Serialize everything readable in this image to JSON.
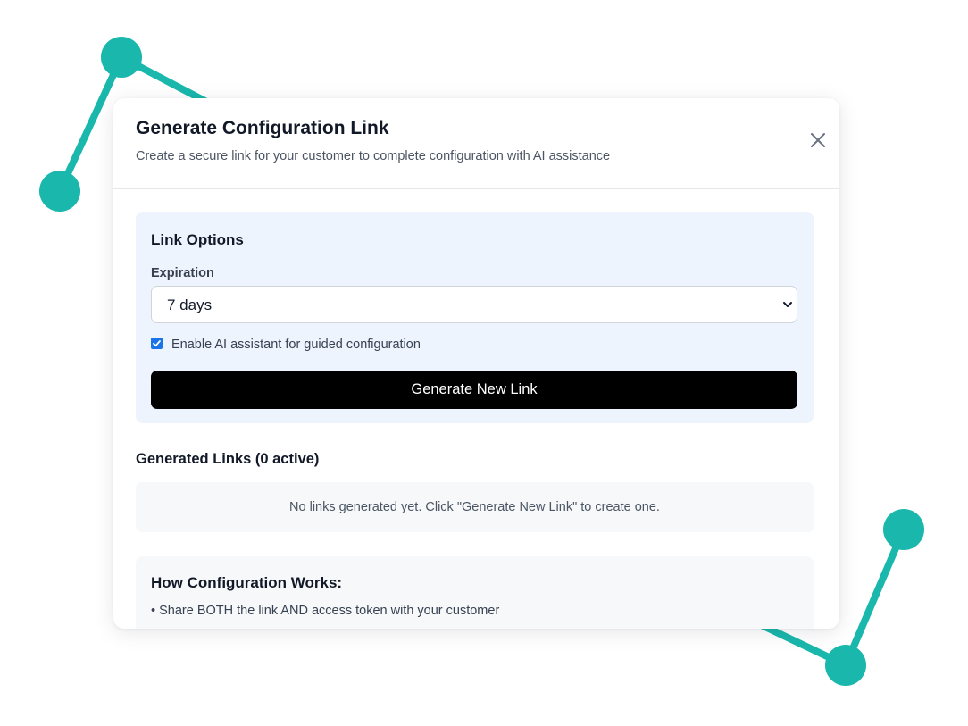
{
  "modal": {
    "title": "Generate Configuration Link",
    "description": "Create a secure link for your customer to complete configuration with AI assistance",
    "close_icon": "close-icon"
  },
  "link_options": {
    "title": "Link Options",
    "expiration_label": "Expiration",
    "expiration_value": "7 days",
    "ai_assistant_checked": true,
    "ai_assistant_label": "Enable AI assistant for guided configuration",
    "generate_button": "Generate New Link"
  },
  "generated_links": {
    "title": "Generated Links (0 active)",
    "empty_message": "No links generated yet. Click \"Generate New Link\" to create one."
  },
  "how_it_works": {
    "title": "How Configuration Works:",
    "items": [
      "• Share BOTH the link AND access token with your customer"
    ]
  },
  "colors": {
    "accent_teal": "#1ab7ac",
    "options_panel_bg": "#eef4fd",
    "primary_button_bg": "#000000",
    "checkbox_blue": "#1a73e8"
  }
}
